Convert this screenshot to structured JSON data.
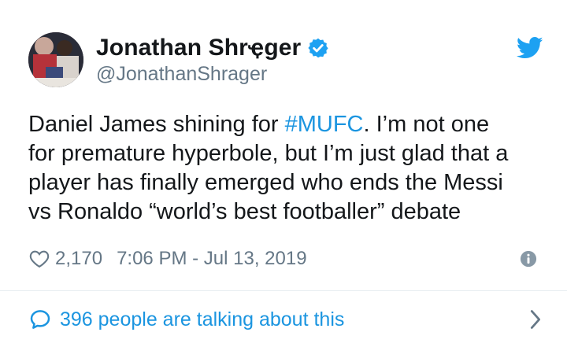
{
  "user": {
    "display_name": "Jonathan Shrҿger",
    "handle": "@JonathanShrager",
    "verified": true,
    "avatar_icon": "profile-photo"
  },
  "brand": {
    "icon": "twitter-bird-icon",
    "color": "#1da1f2"
  },
  "tweet": {
    "lines": [
      [
        "Daniel James shining for ",
        "#MUFC",
        ". I’m not one"
      ],
      [
        "for premature hyperbole, but I’m just glad that a"
      ],
      [
        "player has finally emerged who ends the Messi"
      ],
      [
        "vs Ronaldo “world’s best footballer” debate"
      ]
    ],
    "hashtag": "#MUFC",
    "hashtag_color": "#1b95e0"
  },
  "meta": {
    "likes": "2,170",
    "timestamp": "7:06 PM - Jul 13, 2019",
    "heart_icon": "heart-outline-icon",
    "info_icon": "info-icon"
  },
  "footer": {
    "talking_text": "396 people are talking about this",
    "bubble_icon": "speech-bubble-icon",
    "chevron_icon": "chevron-right-icon",
    "link_color": "#1b95e0"
  }
}
